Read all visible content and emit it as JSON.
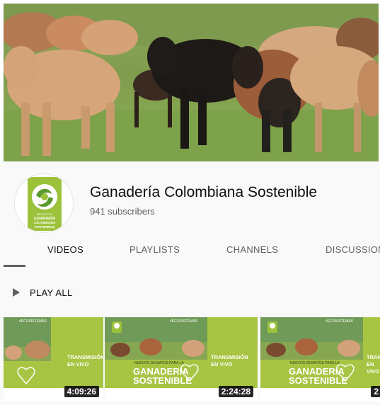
{
  "channel": {
    "name": "Ganadería Colombiana Sostenible",
    "subscribers": "941 subscribers",
    "logo_text": [
      "PROYECTO",
      "GANADERÍA",
      "COLOMBIANA",
      "SOSTENIBLE"
    ]
  },
  "tabs": [
    {
      "label": "VIDEOS",
      "active": true
    },
    {
      "label": "PLAYLISTS",
      "active": false
    },
    {
      "label": "CHANNELS",
      "active": false
    },
    {
      "label": "DISCUSSION",
      "active": false
    }
  ],
  "play_all_label": "PLAY ALL",
  "videos": [
    {
      "duration": "4:09:26",
      "live_text": [
        "TRANSMISIÓN",
        "EN VIVO"
      ],
      "tag": "#ECOSISTEMAS"
    },
    {
      "duration": "2:24:28",
      "live_text": [
        "TRANSMISIÓN",
        "EN VIVO"
      ],
      "subtitle": "NUEVOS DESAFÍOS PARA LA",
      "title_lines": [
        "GANADERÍA",
        "SOSTENIBLE"
      ],
      "tag": "#ECOSISTEMAS"
    },
    {
      "duration": "2",
      "live_text": [
        "TRANSMISIÓN",
        "EN VIVO"
      ],
      "subtitle": "NUEVOS DESAFÍOS PARA LA",
      "title_lines": [
        "GANADERÍA",
        "SOSTENIBLE"
      ],
      "tag": "#ECOSISTEMAS"
    }
  ],
  "colors": {
    "brand_green": "#a8c443",
    "header_bg": "#f9f9f9",
    "text_primary": "#0f0f0f",
    "text_secondary": "#606060"
  }
}
